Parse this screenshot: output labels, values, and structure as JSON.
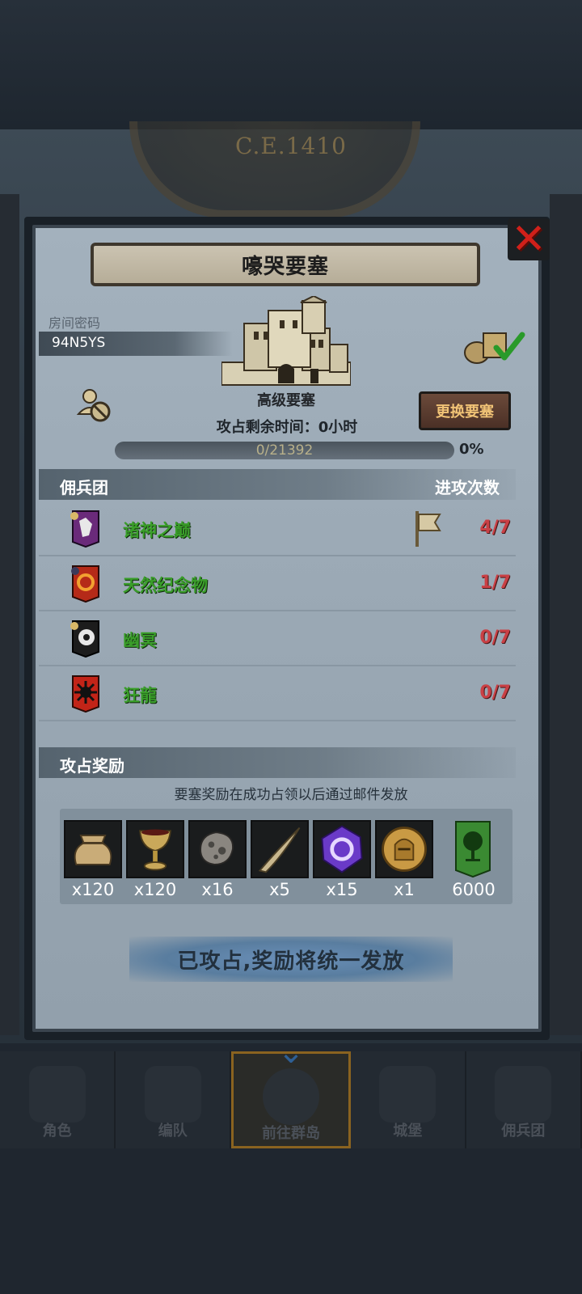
{
  "background": {
    "era_label": "C.E.1410"
  },
  "dialog": {
    "title": "嚎哭要塞",
    "room_code_label": "房间密码",
    "room_code": "94N5YS",
    "fortress_type": "高级要塞",
    "change_button": "更换要塞",
    "time_remaining": "攻占剩余时间：0小时",
    "progress": {
      "current": 0,
      "total": 21392,
      "text": "0/21392",
      "percent_text": "0%"
    },
    "mercenary_header": "佣兵团",
    "attack_count_header": "进攻次数",
    "mercenaries": [
      {
        "name": "诸神之巅",
        "count": "4/7",
        "emblem": "white-wolf-emblem",
        "flag": true
      },
      {
        "name": "天然纪念物",
        "count": "1/7",
        "emblem": "fire-ring-emblem",
        "flag": false
      },
      {
        "name": "幽冥",
        "count": "0/7",
        "emblem": "white-spiral-emblem",
        "flag": false
      },
      {
        "name": "狂龍",
        "count": "0/7",
        "emblem": "black-sun-emblem",
        "flag": false
      }
    ],
    "rewards_header": "攻占奖励",
    "rewards_note": "要塞奖励在成功占领以后通过邮件发放",
    "rewards": [
      {
        "icon": "sack-icon",
        "qty": "x120"
      },
      {
        "icon": "goblet-icon",
        "qty": "x120"
      },
      {
        "icon": "ore-icon",
        "qty": "x16"
      },
      {
        "icon": "horn-icon",
        "qty": "x5"
      },
      {
        "icon": "purple-crystal-icon",
        "qty": "x15"
      },
      {
        "icon": "knight-medal-icon",
        "qty": "x1"
      },
      {
        "icon": "tree-banner-icon",
        "qty": "6000"
      }
    ],
    "claim_status": "已攻占,奖励将统一发放"
  },
  "nav": {
    "items": [
      {
        "label": "角色",
        "icon": "knight-icon"
      },
      {
        "label": "编队",
        "icon": "formation-icon"
      },
      {
        "label": "前往群岛",
        "icon": "globe-icon",
        "active": true
      },
      {
        "label": "城堡",
        "icon": "castle-icon"
      },
      {
        "label": "佣兵团",
        "icon": "mercenary-icon"
      }
    ]
  },
  "colors": {
    "panel": "#9aa8b4",
    "mercenary_name": "#3a9e2a",
    "attack_count": "#c94045",
    "button_text": "#f1c376",
    "close": "#d0201a"
  }
}
